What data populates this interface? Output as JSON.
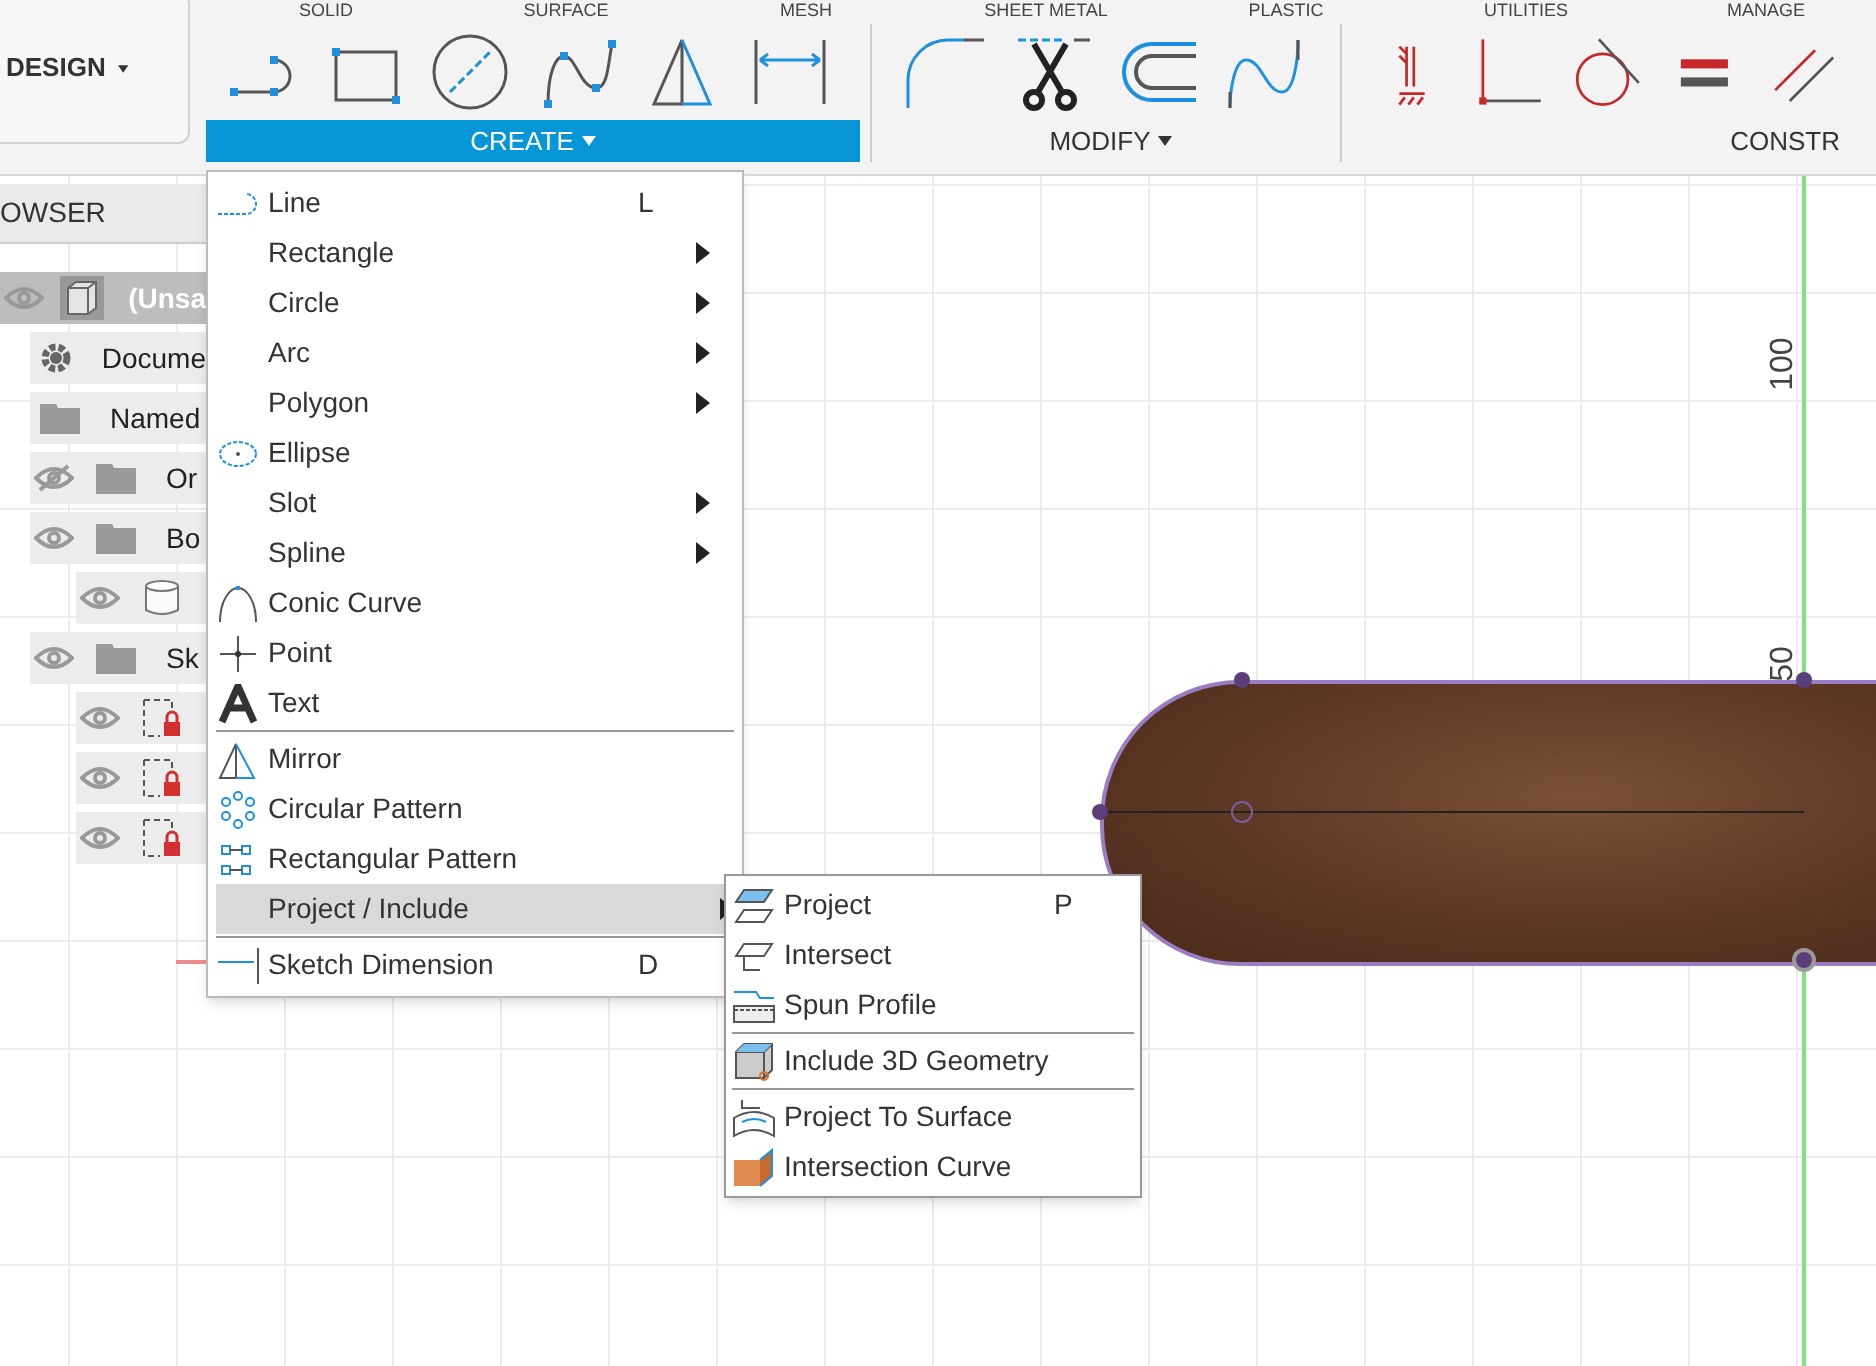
{
  "workspace_button": {
    "label": "DESIGN"
  },
  "toolbar_tabs": [
    "SOLID",
    "SURFACE",
    "MESH",
    "SHEET METAL",
    "PLASTIC",
    "UTILITIES",
    "MANAGE"
  ],
  "toolbar_groups": [
    {
      "label": "CREATE",
      "selected": true
    },
    {
      "label": "MODIFY",
      "selected": false
    },
    {
      "label": "CONSTR",
      "selected": false
    }
  ],
  "browser": {
    "title": "OWSER",
    "items": [
      {
        "label": "(Unsa",
        "kind": "component",
        "visible": true,
        "selected": true,
        "children": [
          {
            "label": "Docume",
            "kind": "settings",
            "selected": false
          },
          {
            "label": "Named",
            "kind": "folder",
            "selected": false
          },
          {
            "label": "Or",
            "kind": "folder",
            "visible": false,
            "selected": false
          },
          {
            "label": "Bo",
            "kind": "folder",
            "visible": true,
            "selected": false,
            "children": [
              {
                "kind": "body",
                "visible": true,
                "selected": false
              }
            ]
          },
          {
            "label": "Sk",
            "kind": "folder",
            "visible": true,
            "selected": false,
            "children": [
              {
                "kind": "sketch",
                "visible": true,
                "selected": false
              },
              {
                "kind": "sketch",
                "visible": true,
                "selected": false
              },
              {
                "kind": "sketch",
                "visible": true,
                "selected": false
              }
            ]
          }
        ]
      }
    ]
  },
  "create_menu": {
    "sections": [
      [
        {
          "label": "Line",
          "kind": "line",
          "shortcut": "L",
          "submenu": false,
          "selected": false
        },
        {
          "label": "Rectangle",
          "submenu": true,
          "selected": false
        },
        {
          "label": "Circle",
          "submenu": true,
          "selected": false
        },
        {
          "label": "Arc",
          "submenu": true,
          "selected": false
        },
        {
          "label": "Polygon",
          "submenu": true,
          "selected": false
        },
        {
          "label": "Ellipse",
          "kind": "ellipse",
          "submenu": false,
          "selected": false
        },
        {
          "label": "Slot",
          "submenu": true,
          "selected": false
        },
        {
          "label": "Spline",
          "submenu": true,
          "selected": false
        },
        {
          "label": "Conic Curve",
          "kind": "conic",
          "submenu": false,
          "selected": false
        },
        {
          "label": "Point",
          "kind": "point",
          "submenu": false,
          "selected": false
        },
        {
          "label": "Text",
          "kind": "text",
          "submenu": false,
          "selected": false
        }
      ],
      [
        {
          "label": "Mirror",
          "kind": "mirror",
          "submenu": false,
          "selected": false
        },
        {
          "label": "Circular Pattern",
          "kind": "circular",
          "submenu": false,
          "selected": false
        },
        {
          "label": "Rectangular Pattern",
          "kind": "rectangular",
          "submenu": false,
          "selected": false
        },
        {
          "label": "Project / Include",
          "submenu": true,
          "selected": true
        }
      ],
      [
        {
          "label": "Sketch Dimension",
          "kind": "dimension",
          "shortcut": "D",
          "submenu": false,
          "selected": false
        }
      ]
    ]
  },
  "project_submenu": {
    "sections": [
      [
        {
          "label": "Project",
          "kind": "project",
          "shortcut": "P"
        },
        {
          "label": "Intersect",
          "kind": "intersect"
        },
        {
          "label": "Spun Profile",
          "kind": "spun"
        }
      ],
      [
        {
          "label": "Include 3D Geometry",
          "kind": "include"
        }
      ],
      [
        {
          "label": "Project To Surface",
          "kind": "surface"
        },
        {
          "label": "Intersection Curve",
          "kind": "curve"
        }
      ]
    ]
  },
  "canvas": {
    "axis_labels": [
      "100",
      "50"
    ]
  }
}
